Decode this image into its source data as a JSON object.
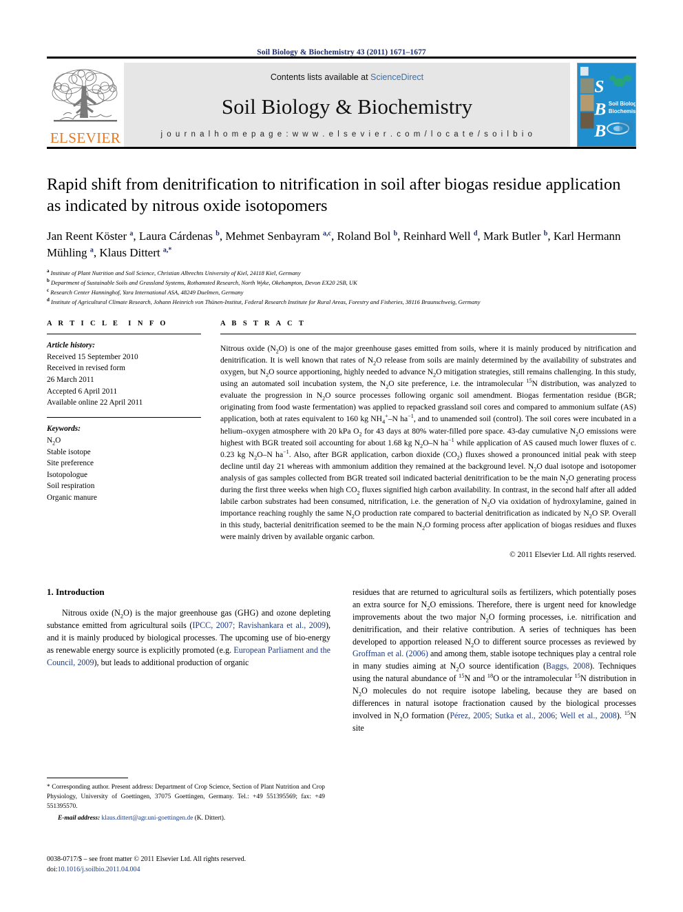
{
  "running_head": "Soil Biology & Biochemistry 43 (2011) 1671–1677",
  "masthead": {
    "publisher_name": "ELSEVIER",
    "contents_prefix": "Contents lists available at ",
    "sciencedirect": "ScienceDirect",
    "journal_title": "Soil Biology & Biochemistry",
    "homepage": "j o u r n a l   h o m e p a g e :   w w w . e l s e v i e r . c o m / l o c a t e / s o i l b i o",
    "cover_letters": [
      "S",
      "B",
      "B"
    ],
    "cover_caption_line1": "Soil Biology &",
    "cover_caption_line2": "Biochemistry"
  },
  "article": {
    "title": "Rapid shift from denitrification to nitrification in soil after biogas residue application as indicated by nitrous oxide isotopomers",
    "authors": [
      {
        "name": "Jan Reent Köster",
        "marks": "a"
      },
      {
        "name": "Laura Cárdenas",
        "marks": "b"
      },
      {
        "name": "Mehmet Senbayram",
        "marks": "a,c"
      },
      {
        "name": "Roland Bol",
        "marks": "b"
      },
      {
        "name": "Reinhard Well",
        "marks": "d"
      },
      {
        "name": "Mark Butler",
        "marks": "b"
      },
      {
        "name": "Karl Hermann Mühling",
        "marks": "a"
      },
      {
        "name": "Klaus Dittert",
        "marks": "a,*"
      }
    ],
    "affiliations": [
      {
        "mark": "a",
        "text": "Institute of Plant Nutrition and Soil Science, Christian Albrechts University of Kiel, 24118 Kiel, Germany"
      },
      {
        "mark": "b",
        "text": "Department of Sustainable Soils and Grassland Systems, Rothamsted Research, North Wyke, Okehampton, Devon EX20 2SB, UK"
      },
      {
        "mark": "c",
        "text": "Research Center Hanninghof, Yara International ASA, 48249 Duelmen, Germany"
      },
      {
        "mark": "d",
        "text": "Institute of Agricultural Climate Research, Johann Heinrich von Thünen-Institut, Federal Research Institute for Rural Areas, Forestry and Fisheries, 38116 Braunschweig, Germany"
      }
    ]
  },
  "article_info": {
    "heading": "ARTICLE INFO",
    "history_label": "Article history:",
    "history": [
      "Received 15 September 2010",
      "Received in revised form",
      "26 March 2011",
      "Accepted 6 April 2011",
      "Available online 22 April 2011"
    ],
    "keywords_label": "Keywords:",
    "keywords": [
      "N2O",
      "Stable isotope",
      "Site preference",
      "Isotopologue",
      "Soil respiration",
      "Organic manure"
    ]
  },
  "abstract": {
    "heading": "ABSTRACT",
    "copyright": "© 2011 Elsevier Ltd. All rights reserved."
  },
  "introduction": {
    "heading": "1. Introduction"
  },
  "footnote": {
    "corresponding": "* Corresponding author. Present address: Department of Crop Science, Section of Plant Nutrition and Crop Physiology, University of Goettingen, 37075 Goettingen, Germany. Tel.: +49 551395569; fax: +49 551395570.",
    "email_label": "E-mail address:",
    "email": "klaus.dittert@agr.uni-goettingen.de",
    "email_suffix": " (K. Dittert)."
  },
  "issn": {
    "line1": "0038-0717/$ – see front matter © 2011 Elsevier Ltd. All rights reserved.",
    "doi_label": "doi:",
    "doi": "10.1016/j.soilbio.2011.04.004"
  },
  "colors": {
    "elsevier_orange": "#E87722",
    "link_blue": "#1a3a82",
    "running_head_blue": "#1a2a66",
    "band_gray": "#e6e6e6",
    "cover_blue": "#1f8fd0"
  }
}
